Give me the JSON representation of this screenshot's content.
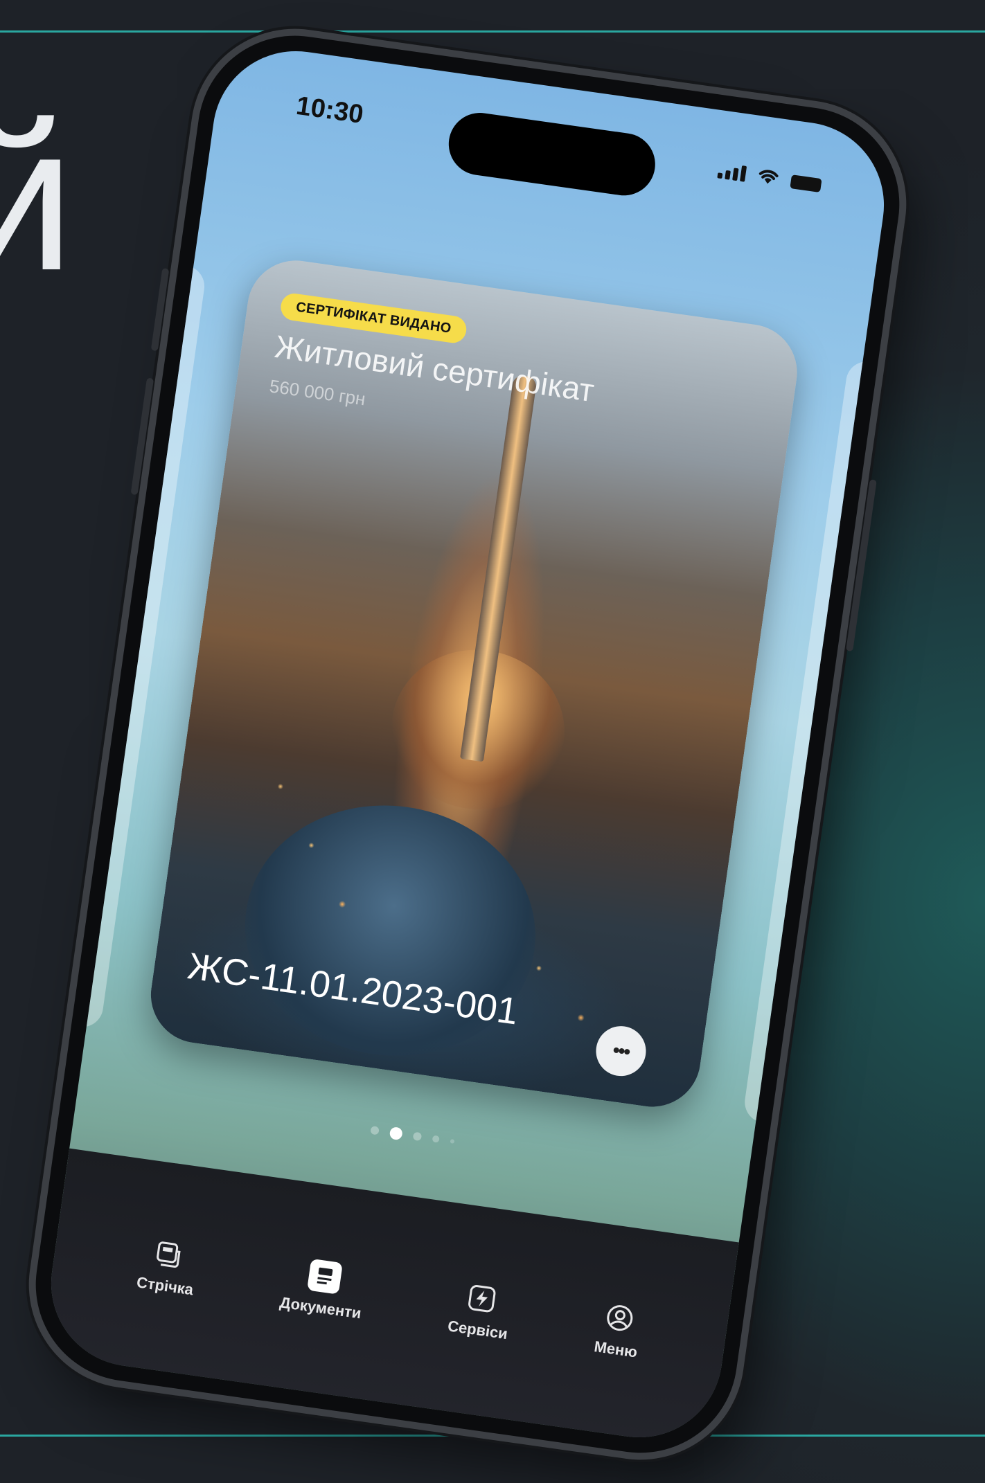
{
  "background": {
    "text": "й",
    "accent_color": "#2aa7a0"
  },
  "status_bar": {
    "time": "10:30"
  },
  "card": {
    "badge": "СЕРТИФІКАТ ВИДАНО",
    "title": "Житловий сертифікат",
    "amount": "560 000 грн",
    "id": "ЖС-11.01.2023-001",
    "more_icon": "more-icon"
  },
  "pagination": {
    "count": 5,
    "active_index": 1
  },
  "tabbar": {
    "items": [
      {
        "label": "Стрічка",
        "icon": "feed-icon"
      },
      {
        "label": "Документи",
        "icon": "documents-icon",
        "active": true
      },
      {
        "label": "Сервіси",
        "icon": "services-icon"
      },
      {
        "label": "Меню",
        "icon": "profile-icon"
      }
    ]
  }
}
